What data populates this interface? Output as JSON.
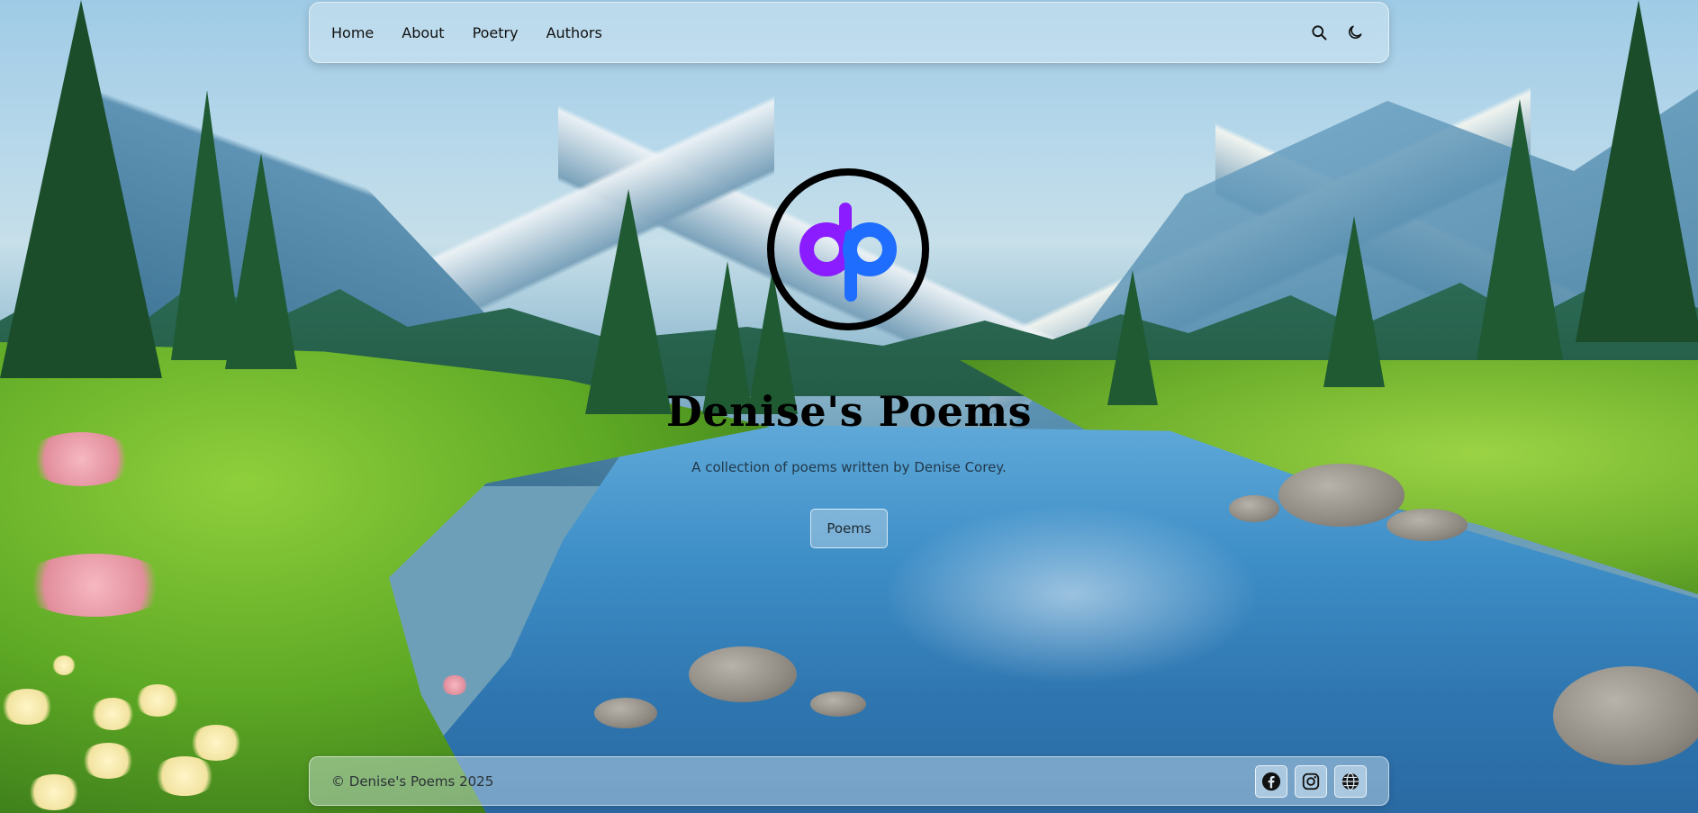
{
  "nav": {
    "links": [
      {
        "label": "Home"
      },
      {
        "label": "About"
      },
      {
        "label": "Poetry"
      },
      {
        "label": "Authors"
      }
    ],
    "icons": [
      "search-icon",
      "moon-icon"
    ]
  },
  "hero": {
    "logo_letters": "dp",
    "title": "Denise's Poems",
    "subtitle": "A collection of poems written by Denise Corey.",
    "button_label": "Poems"
  },
  "footer": {
    "copyright": "© Denise's Poems 2025",
    "social_icons": [
      "facebook-icon",
      "instagram-icon",
      "globe-icon"
    ]
  },
  "colors": {
    "logo_d": "#8a1cff",
    "logo_p": "#1e6dff",
    "title": "#000000"
  }
}
